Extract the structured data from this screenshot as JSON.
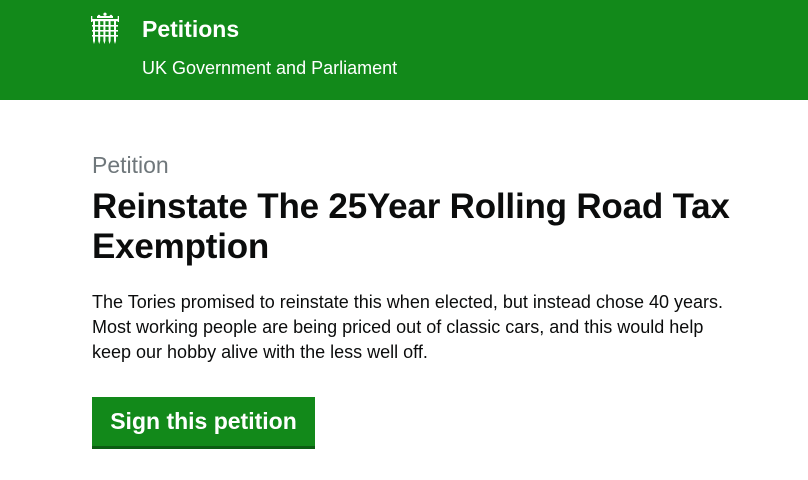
{
  "header": {
    "title": "Petitions",
    "subtitle": "UK Government and Parliament",
    "logo_icon": "portcullis-icon",
    "background_color": "#12891a"
  },
  "petition": {
    "kicker": "Petition",
    "title": "Reinstate The 25Year Rolling Road Tax Exemption",
    "description": [
      "The Tories promised to reinstate this when elected, but instead chose 40 years.",
      "Most working people are being priced out of classic cars, and this would help keep our hobby alive with the less well off."
    ]
  },
  "actions": {
    "sign_label": "Sign this petition",
    "button_color": "#12891a"
  }
}
